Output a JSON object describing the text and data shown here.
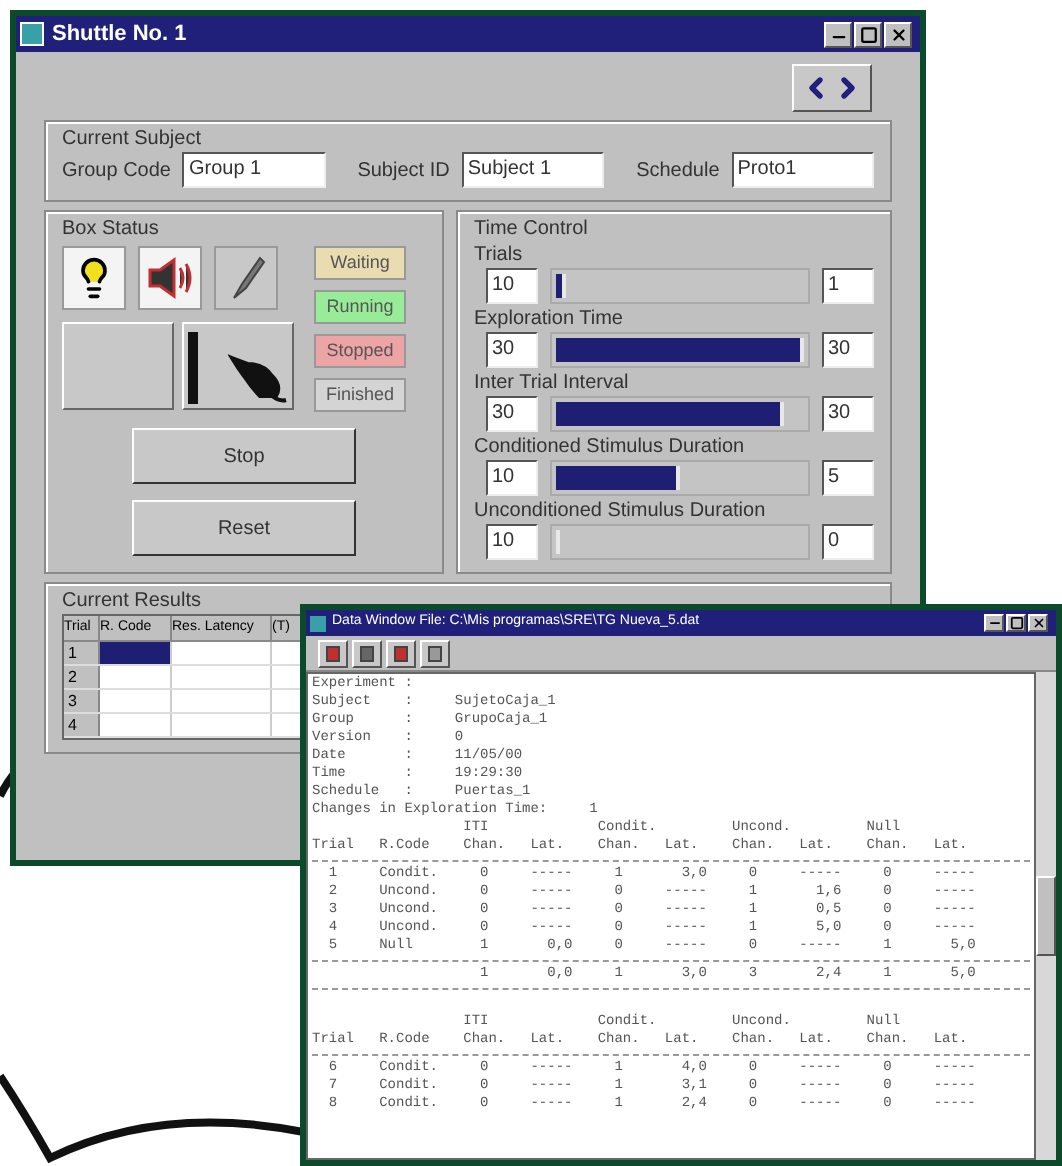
{
  "main_window": {
    "title": "Shuttle No. 1",
    "current_subject": {
      "legend": "Current Subject",
      "fields": [
        {
          "label": "Group Code",
          "value": "Group 1"
        },
        {
          "label": "Subject ID",
          "value": "Subject 1"
        },
        {
          "label": "Schedule",
          "value": "Proto1"
        }
      ]
    },
    "box_status": {
      "legend": "Box Status",
      "statuses": [
        {
          "label": "Waiting",
          "color": "#e8dcb0"
        },
        {
          "label": "Running",
          "color": "#98ec98"
        },
        {
          "label": "Stopped",
          "color": "#eca4a4"
        },
        {
          "label": "Finished",
          "color": "#d4d4d4"
        }
      ],
      "buttons": [
        "Stop",
        "Reset"
      ]
    },
    "time_control": {
      "legend": "Time Control",
      "controls": [
        {
          "label": "Trials",
          "value": "10",
          "level": 0.04,
          "reading": "1"
        },
        {
          "label": "Exploration Time",
          "value": "30",
          "level": 1,
          "reading": "30"
        },
        {
          "label": "Inter Trial Interval",
          "value": "30",
          "level": 0.92,
          "reading": "30"
        },
        {
          "label": "Conditioned Stimulus Duration",
          "value": "10",
          "level": 0.5,
          "reading": "5"
        },
        {
          "label": "Unconditioned Stimulus Duration",
          "value": "10",
          "level": 0,
          "reading": "0"
        }
      ]
    },
    "current_results": {
      "legend": "Current Results",
      "columns": [
        "Trial",
        "R. Code",
        "Res. Latency",
        "(T)"
      ],
      "rows": [
        {
          "trial": "1",
          "selected": true
        },
        {
          "trial": "2",
          "selected": false
        },
        {
          "trial": "3",
          "selected": false
        },
        {
          "trial": "4",
          "selected": false
        }
      ]
    }
  },
  "data_window": {
    "title": "Data Window File: C:\\Mis programas\\SRE\\TG Nueva_5.dat",
    "lines": [
      {
        "kind": "text",
        "text": "Experiment :"
      },
      {
        "kind": "text",
        "text": "Subject    :     SujetoCaja_1"
      },
      {
        "kind": "text",
        "text": "Group      :     GrupoCaja_1"
      },
      {
        "kind": "text",
        "text": "Version    :     0"
      },
      {
        "kind": "text",
        "text": "Date       :     11/05/00"
      },
      {
        "kind": "text",
        "text": "Time       :     19:29:30"
      },
      {
        "kind": "text",
        "text": "Schedule   :     Puertas_1"
      },
      {
        "kind": "text",
        "text": "Changes in Exploration Time:     1"
      },
      {
        "kind": "text",
        "text": "                  ITI             Condit.         Uncond.         Null"
      },
      {
        "kind": "text",
        "text": "Trial   R.Code    Chan.   Lat.    Chan.   Lat.    Chan.   Lat.    Chan.   Lat."
      },
      {
        "kind": "rule"
      },
      {
        "kind": "text",
        "text": "  1     Condit.     0     -----     1       3,0     0     -----     0     -----"
      },
      {
        "kind": "text",
        "text": "  2     Uncond.     0     -----     0     -----     1       1,6     0     -----"
      },
      {
        "kind": "text",
        "text": "  3     Uncond.     0     -----     0     -----     1       0,5     0     -----"
      },
      {
        "kind": "text",
        "text": "  4     Uncond.     0     -----     0     -----     1       5,0     0     -----"
      },
      {
        "kind": "text",
        "text": "  5     Null        1       0,0     0     -----     0     -----     1       5,0"
      },
      {
        "kind": "rule"
      },
      {
        "kind": "text",
        "text": "                    1       0,0     1       3,0     3       2,4     1       5,0"
      },
      {
        "kind": "rule"
      },
      {
        "kind": "space"
      },
      {
        "kind": "text",
        "text": "                  ITI             Condit.         Uncond.         Null"
      },
      {
        "kind": "text",
        "text": "Trial   R.Code    Chan.   Lat.    Chan.   Lat.    Chan.   Lat.    Chan.   Lat."
      },
      {
        "kind": "rule"
      },
      {
        "kind": "text",
        "text": "  6     Condit.     0     -----     1       4,0     0     -----     0     -----"
      },
      {
        "kind": "text",
        "text": "  7     Condit.     0     -----     1       3,1     0     -----     0     -----"
      },
      {
        "kind": "text",
        "text": "  8     Condit.     0     -----     1       2,4     0     -----     0     -----"
      }
    ]
  }
}
